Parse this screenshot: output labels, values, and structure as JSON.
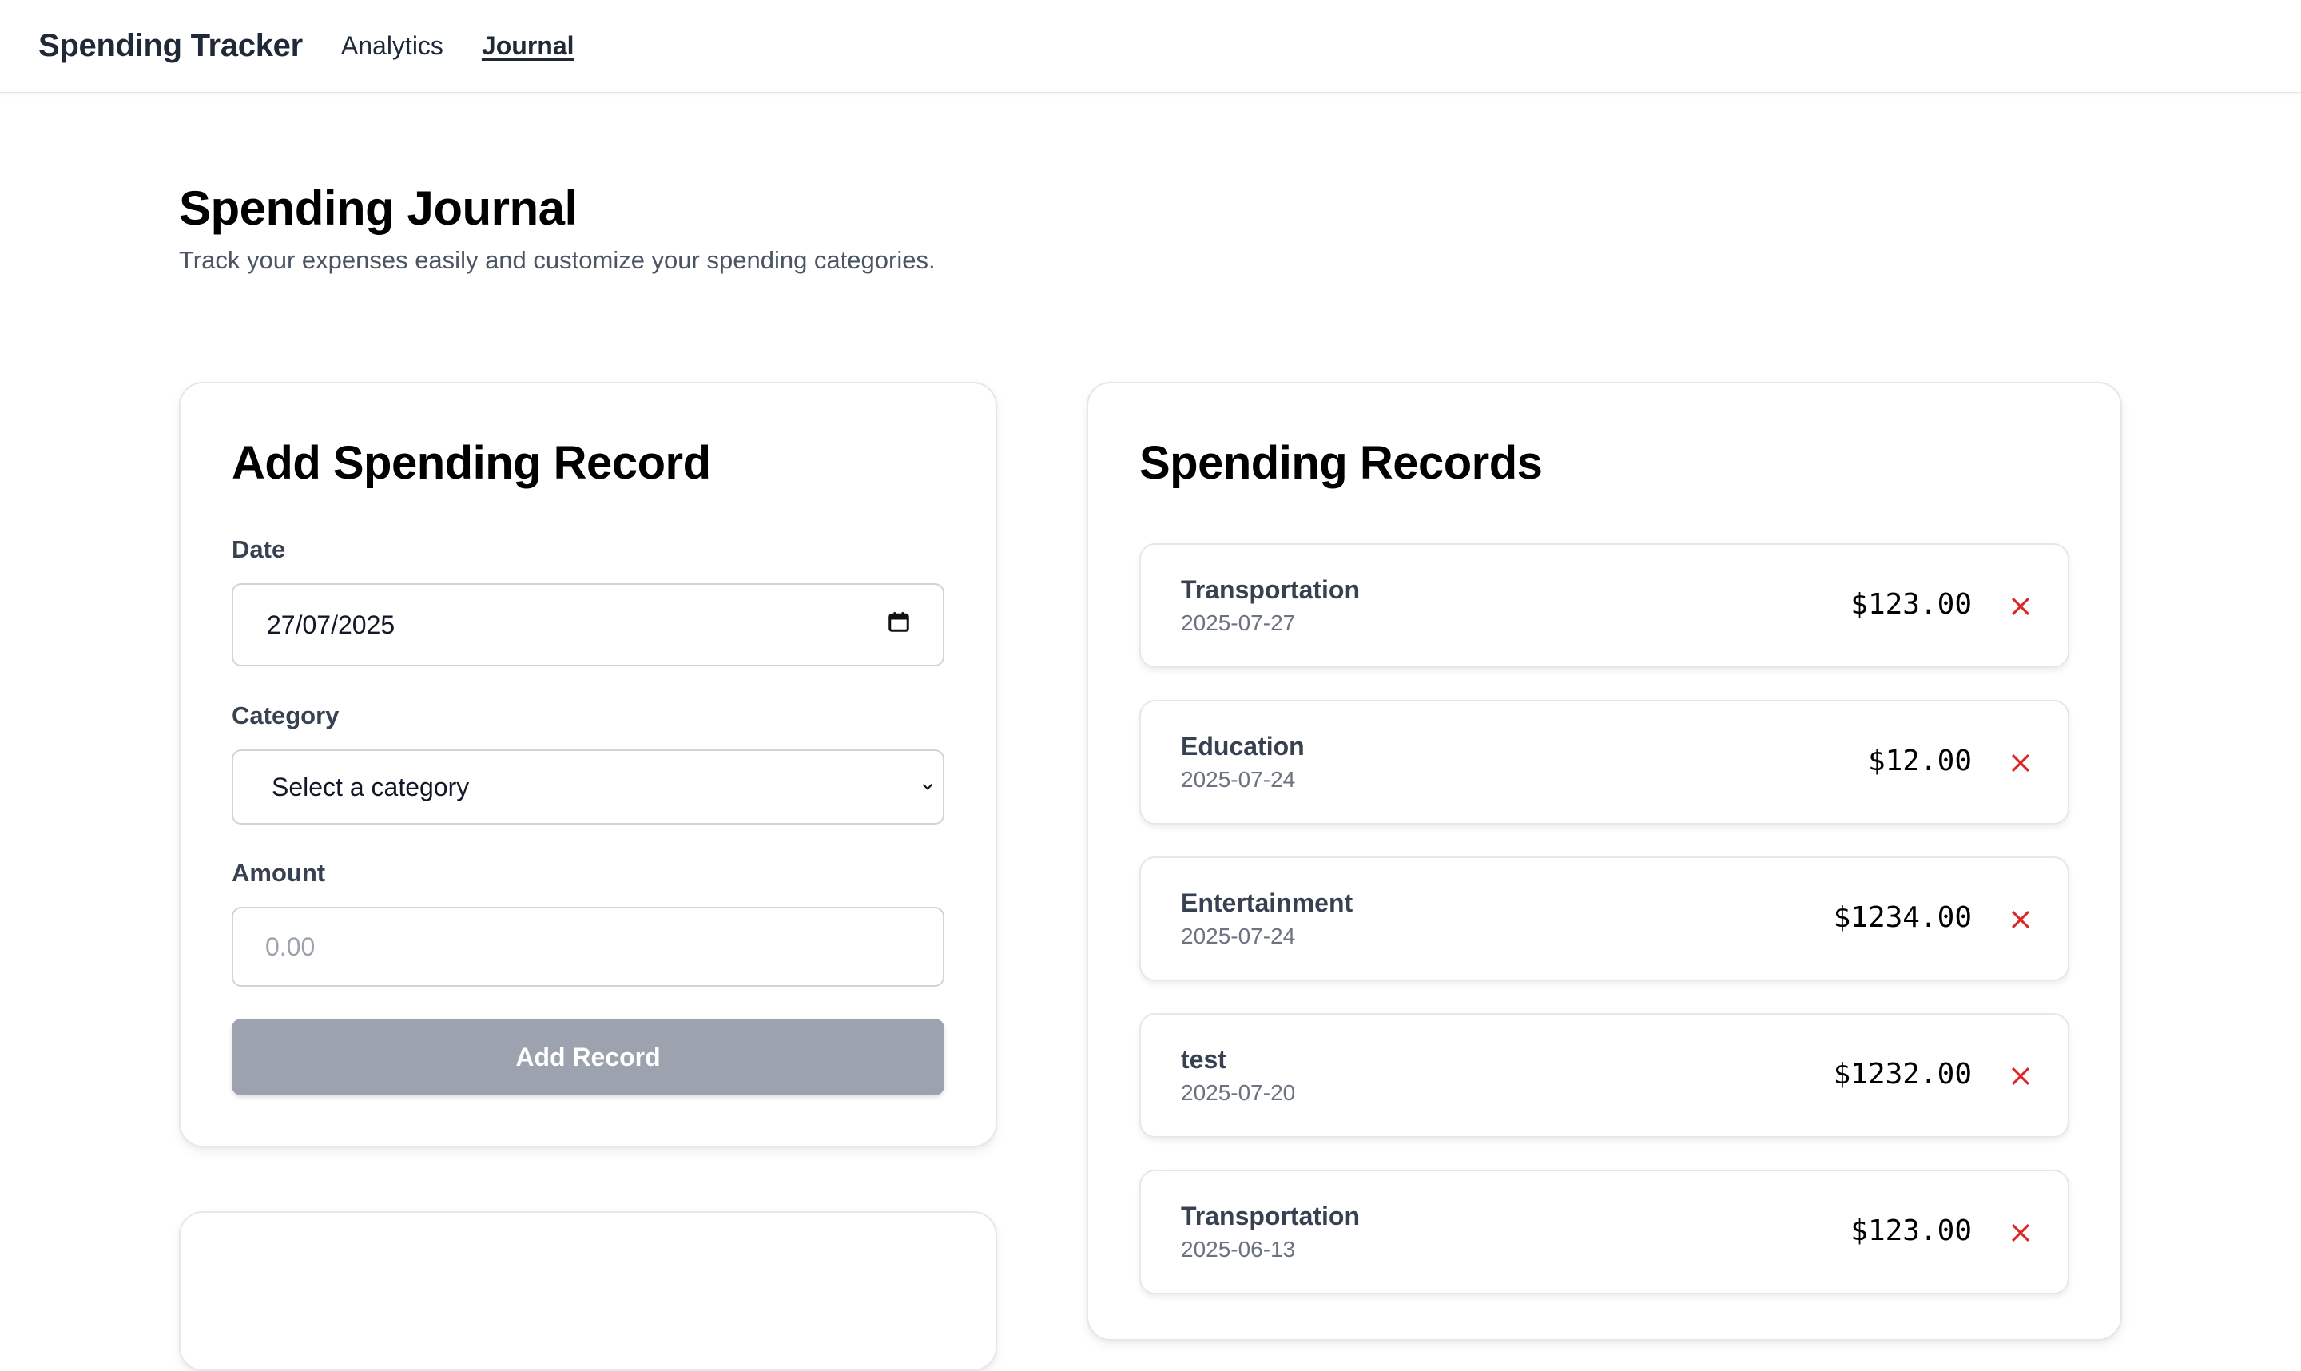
{
  "nav": {
    "brand": "Spending Tracker",
    "links": [
      "Analytics",
      "Journal"
    ],
    "active": "Journal"
  },
  "page": {
    "title": "Spending Journal",
    "subtitle": "Track your expenses easily and customize your spending categories."
  },
  "form": {
    "title": "Add Spending Record",
    "date_label": "Date",
    "date_value": "27/07/2025",
    "category_label": "Category",
    "category_selected": "Select a category",
    "amount_label": "Amount",
    "amount_placeholder": "0.00",
    "submit_label": "Add Record"
  },
  "records": {
    "title": "Spending Records",
    "items": [
      {
        "category": "Transportation",
        "date": "2025-07-27",
        "amount": "$123.00"
      },
      {
        "category": "Education",
        "date": "2025-07-24",
        "amount": "$12.00"
      },
      {
        "category": "Entertainment",
        "date": "2025-07-24",
        "amount": "$1234.00"
      },
      {
        "category": "test",
        "date": "2025-07-20",
        "amount": "$1232.00"
      },
      {
        "category": "Transportation",
        "date": "2025-06-13",
        "amount": "$123.00"
      }
    ]
  },
  "icons": {
    "date_picker": "calendar-icon",
    "select": "chevron-down-icon",
    "delete": "close-icon"
  },
  "colors": {
    "delete": "#dc2626",
    "button_disabled": "#9ca3af"
  }
}
